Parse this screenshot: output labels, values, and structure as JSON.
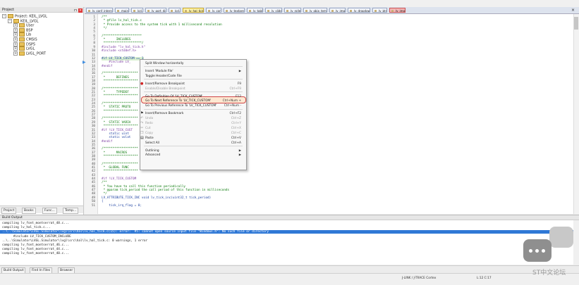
{
  "project_panel": {
    "title": "Project",
    "tree": [
      {
        "label": "Project: KEIL_LVGL",
        "level": 0
      },
      {
        "label": "KEIL_LVGL",
        "level": 1
      },
      {
        "label": "User",
        "level": 2
      },
      {
        "label": "BSP",
        "level": 2
      },
      {
        "label": "Lib",
        "level": 2
      },
      {
        "label": "CMSIS",
        "level": 2
      },
      {
        "label": "DSP5",
        "level": 2
      },
      {
        "label": "LVGL",
        "level": 2
      },
      {
        "label": "LVGL_PORT",
        "level": 2
      }
    ],
    "tabs": [
      "Project",
      "Books",
      "Func...",
      "Temp..."
    ]
  },
  "file_tabs": [
    {
      "label": "lv_conf_internal.h",
      "state": "normal"
    },
    {
      "label": "main.c",
      "state": "normal"
    },
    {
      "label": "lcd.c",
      "state": "normal"
    },
    {
      "label": "lv_port_disp.c",
      "state": "normal"
    },
    {
      "label": "lcd.h",
      "state": "normal"
    },
    {
      "label": "lv_hal_tick.c",
      "state": "active"
    },
    {
      "label": "lv_conf.h",
      "state": "normal"
    },
    {
      "label": "lv_textarea.h",
      "state": "normal"
    },
    {
      "label": "lv_table.h",
      "state": "normal"
    },
    {
      "label": "lv_slider.h",
      "state": "normal"
    },
    {
      "label": "lv_roller.h",
      "state": "normal"
    },
    {
      "label": "lv_objx_templ.c",
      "state": "normal"
    },
    {
      "label": "lv_img.h",
      "state": "normal"
    },
    {
      "label": "lv_dropdown.h",
      "state": "normal"
    },
    {
      "label": "lv_btn.c",
      "state": "normal"
    },
    {
      "label": "lv_img.h",
      "state": "red"
    }
  ],
  "code_lines": [
    {
      "n": "1",
      "t": "/**",
      "k": "cmt"
    },
    {
      "n": "2",
      "t": " * @file lv_hal_tick.c",
      "k": "cmt"
    },
    {
      "n": "3",
      "t": " * Provide access to the system tick with 1 millisecond resolution",
      "k": "cmt"
    },
    {
      "n": "4",
      "t": " */",
      "k": "cmt"
    },
    {
      "n": "5",
      "t": "",
      "k": ""
    },
    {
      "n": "6",
      "t": "/*********************",
      "k": "cmt"
    },
    {
      "n": "7",
      "t": " *      INCLUDES",
      "k": "cmt"
    },
    {
      "n": "8",
      "t": " *********************/",
      "k": "cmt"
    },
    {
      "n": "9",
      "t": "#include \"lv_hal_tick.h\"",
      "k": "pre"
    },
    {
      "n": "10",
      "t": "#include <stddef.h>",
      "k": "pre"
    },
    {
      "n": "11",
      "t": "",
      "k": ""
    },
    {
      "n": "12",
      "t": "#if LV_TICK_CUSTOM == 1",
      "k": "hl"
    },
    {
      "n": "13",
      "t": "    #include LV_",
      "k": "pre"
    },
    {
      "n": "14",
      "t": "#endif",
      "k": "pre"
    },
    {
      "n": "15",
      "t": "",
      "k": ""
    },
    {
      "n": "16",
      "t": "/*******************",
      "k": "cmt"
    },
    {
      "n": "17",
      "t": " *      DEFINES",
      "k": "cmt"
    },
    {
      "n": "18",
      "t": " *******************",
      "k": "cmt"
    },
    {
      "n": "19",
      "t": "",
      "k": ""
    },
    {
      "n": "20",
      "t": "/*******************",
      "k": "cmt"
    },
    {
      "n": "21",
      "t": " *      TYPEDEF",
      "k": "cmt"
    },
    {
      "n": "22",
      "t": " *******************",
      "k": "cmt"
    },
    {
      "n": "23",
      "t": "",
      "k": ""
    },
    {
      "n": "24",
      "t": "/*******************",
      "k": "cmt"
    },
    {
      "n": "25",
      "t": " *  STATIC PROTO",
      "k": "cmt"
    },
    {
      "n": "26",
      "t": " *******************",
      "k": "cmt"
    },
    {
      "n": "27",
      "t": "",
      "k": ""
    },
    {
      "n": "28",
      "t": "/*******************",
      "k": "cmt"
    },
    {
      "n": "29",
      "t": " *  STATIC VARIA",
      "k": "cmt"
    },
    {
      "n": "30",
      "t": " *******************",
      "k": "cmt"
    },
    {
      "n": "31",
      "t": "#if !LV_TICK_CUST",
      "k": "pre"
    },
    {
      "n": "32",
      "t": "    static uint",
      "k": ""
    },
    {
      "n": "33",
      "t": "    static volat",
      "k": ""
    },
    {
      "n": "34",
      "t": "#endif",
      "k": "pre"
    },
    {
      "n": "35",
      "t": "",
      "k": ""
    },
    {
      "n": "36",
      "t": "/*******************",
      "k": "cmt"
    },
    {
      "n": "37",
      "t": " *      MACROS",
      "k": "cmt"
    },
    {
      "n": "38",
      "t": " *******************",
      "k": "cmt"
    },
    {
      "n": "39",
      "t": "",
      "k": ""
    },
    {
      "n": "40",
      "t": "/*******************",
      "k": "cmt"
    },
    {
      "n": "41",
      "t": " *  GLOBAL FUNC",
      "k": "cmt"
    },
    {
      "n": "42",
      "t": " *******************",
      "k": "cmt"
    },
    {
      "n": "43",
      "t": "",
      "k": ""
    },
    {
      "n": "44",
      "t": "#if !LV_TICK_CUSTOM",
      "k": "pre"
    },
    {
      "n": "45",
      "t": "/**",
      "k": "cmt"
    },
    {
      "n": "46",
      "t": " * You have to call this function periodically",
      "k": "cmt"
    },
    {
      "n": "47",
      "t": " * @param tick_period the call period of this function in milliseconds",
      "k": "cmt"
    },
    {
      "n": "48",
      "t": " */",
      "k": "cmt"
    },
    {
      "n": "49",
      "t": "LV_ATTRIBUTE_TICK_INC void lv_tick_inc(uint32_t tick_period)",
      "k": ""
    },
    {
      "n": "50",
      "t": "{",
      "k": ""
    },
    {
      "n": "51",
      "t": "    tick_irq_flag = 0;",
      "k": ""
    }
  ],
  "context_menu": [
    {
      "label": "Split Window horizontally",
      "shortcut": "",
      "type": "item"
    },
    {
      "type": "sep"
    },
    {
      "label": "Insert 'Module file'",
      "shortcut": "▶",
      "type": "item"
    },
    {
      "label": "Toggle Header/Code File",
      "shortcut": "",
      "type": "item"
    },
    {
      "type": "sep"
    },
    {
      "label": "Insert/Remove Breakpoint",
      "shortcut": "F9",
      "type": "item",
      "icon": "●"
    },
    {
      "label": "Enable/Disable Breakpoint",
      "shortcut": "Ctrl+F9",
      "type": "item",
      "disabled": true
    },
    {
      "type": "sep"
    },
    {
      "label": "Go To Definition Of 'LV_TICK_CUSTOM'",
      "shortcut": "F12",
      "type": "item",
      "highlighted": true
    },
    {
      "label": "Go To Next Reference To 'LV_TICK_CUSTOM'",
      "shortcut": "Ctrl+Num +",
      "type": "item"
    },
    {
      "label": "Go To Previous Reference To 'LV_TICK_CUSTOM'",
      "shortcut": "Ctrl+Num -",
      "type": "item"
    },
    {
      "type": "sep"
    },
    {
      "label": "Insert/Remove Bookmark",
      "shortcut": "Ctrl+F2",
      "type": "item",
      "icon": "⚑"
    },
    {
      "label": "Undo",
      "shortcut": "Ctrl+Z",
      "type": "item",
      "disabled": true,
      "icon": "↶"
    },
    {
      "label": "Redo",
      "shortcut": "Ctrl+Y",
      "type": "item",
      "disabled": true,
      "icon": "↷"
    },
    {
      "label": "Cut",
      "shortcut": "Ctrl+X",
      "type": "item",
      "disabled": true,
      "icon": "✂"
    },
    {
      "label": "Copy",
      "shortcut": "Ctrl+C",
      "type": "item",
      "disabled": true,
      "icon": "❐"
    },
    {
      "label": "Paste",
      "shortcut": "Ctrl+V",
      "type": "item",
      "icon": "▤"
    },
    {
      "label": "Select All",
      "shortcut": "Ctrl+A",
      "type": "item"
    },
    {
      "type": "sep"
    },
    {
      "label": "Outlining",
      "shortcut": "▶",
      "type": "item"
    },
    {
      "label": "Advanced",
      "shortcut": "▶",
      "type": "item"
    }
  ],
  "build_output": {
    "title": "Build Output",
    "lines": [
      {
        "t": "compiling lv_font_montserrat_48.c...",
        "err": false
      },
      {
        "t": "compiling lv_hal_tick.c...",
        "err": false
      },
      {
        "t": "..\\..\\Simulator\\LVGL.Simulator\\lvgl\\src\\hal\\lv_hal_tick.c(15): error:  #5: cannot open source input file \"Windows.h\": No such file or directory",
        "err": true
      },
      {
        "t": "      #include LV_TICK_CUSTOM_INCLUDE",
        "err": false
      },
      {
        "t": "..\\..\\Simulator\\LVGL.Simulator\\lvgl\\src\\hal\\lv_hal_tick.c: 0 warnings, 1 error",
        "err": false
      },
      {
        "t": "compiling lv_font_montserrat_46.c...",
        "err": false
      },
      {
        "t": "compiling lv_font_montserrat_44.c...",
        "err": false
      },
      {
        "t": "compiling lv_font_montserrat_40.c...",
        "err": false
      }
    ],
    "tabs": [
      "Build Output",
      "Find In Files",
      "Browser"
    ]
  },
  "status": {
    "debugger": "J-LINK / J-TRACE Cortex",
    "position": "L:12 C:17",
    "watermark": "ST中文论坛"
  }
}
